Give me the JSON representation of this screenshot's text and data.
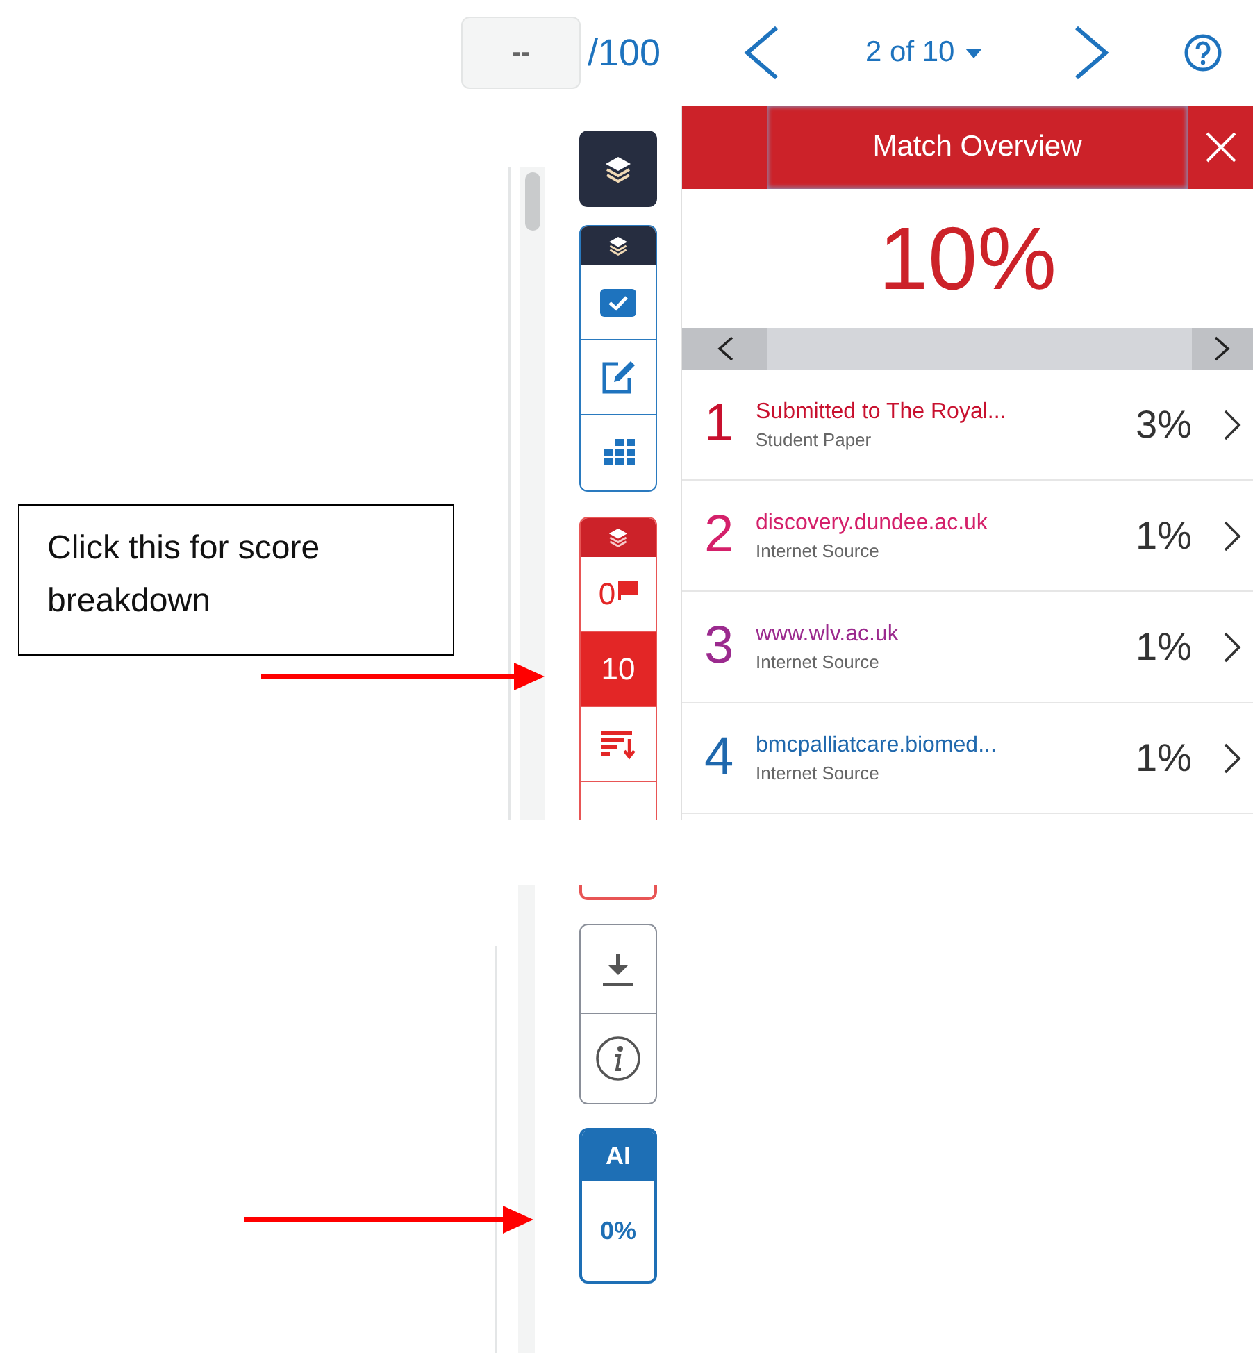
{
  "top_bar": {
    "grade": {
      "value": "--",
      "max": "/100"
    },
    "pager": {
      "label": "2 of 10"
    }
  },
  "toolbar": {
    "similarity": [
      {
        "kind": "flags",
        "text": "0",
        "selected": false
      },
      {
        "kind": "score",
        "text": "10",
        "selected": true
      },
      {
        "kind": "sort",
        "selected": false
      }
    ],
    "ai": {
      "label": "AI",
      "value": "0%"
    }
  },
  "panel": {
    "title": "Match Overview",
    "score": "10%",
    "sources": [
      {
        "rank": "1",
        "name": "Submitted to The Royal...",
        "type": "Student Paper",
        "percent": "3%",
        "color": "#c8102e"
      },
      {
        "rank": "2",
        "name": "discovery.dundee.ac.uk",
        "type": "Internet Source",
        "percent": "1%",
        "color": "#d4206a"
      },
      {
        "rank": "3",
        "name": "www.wlv.ac.uk",
        "type": "Internet Source",
        "percent": "1%",
        "color": "#9b2a8e"
      },
      {
        "rank": "4",
        "name": "bmcpalliatcare.biomed...",
        "type": "Internet Source",
        "percent": "1%",
        "color": "#1f68ad"
      }
    ]
  },
  "annotation": {
    "callout": "Click this for score breakdown"
  }
}
